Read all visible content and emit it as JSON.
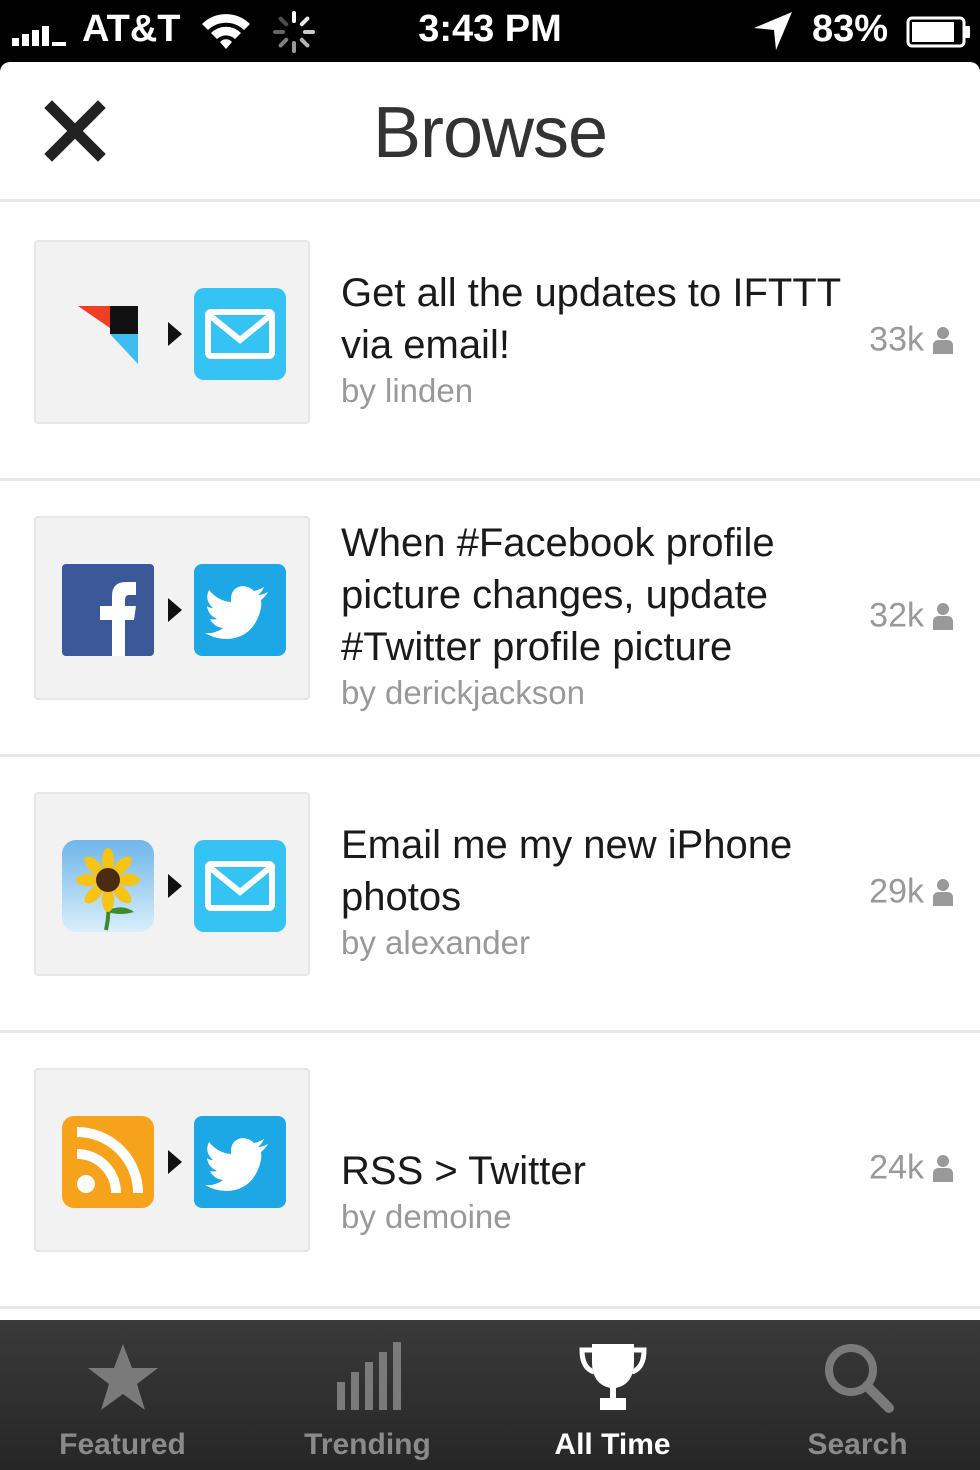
{
  "status_bar": {
    "carrier": "AT&T",
    "time": "3:43 PM",
    "battery_percent": "83%",
    "icons": [
      "signal-icon",
      "wifi-icon",
      "activity-spinner-icon",
      "location-arrow-icon",
      "battery-icon"
    ]
  },
  "navbar": {
    "title": "Browse",
    "close_icon": "close-icon"
  },
  "recipes": [
    {
      "title": "Get all the updates to IFTTT via email!",
      "author": "by linden",
      "count": "33k",
      "trigger_channel": "ifttt-logo-icon",
      "action_channel": "email-icon"
    },
    {
      "title": "When #Facebook profile picture changes, update #Twitter profile picture",
      "author": "by derickjackson",
      "count": "32k",
      "trigger_channel": "facebook-icon",
      "action_channel": "twitter-icon"
    },
    {
      "title": "Email me my new iPhone photos",
      "author": "by alexander",
      "count": "29k",
      "trigger_channel": "iphone-photos-icon",
      "action_channel": "email-icon"
    },
    {
      "title": "RSS > Twitter",
      "author": "by demoine",
      "count": "24k",
      "trigger_channel": "rss-icon",
      "action_channel": "twitter-icon"
    }
  ],
  "tabs": [
    {
      "label": "Featured",
      "icon": "star-icon",
      "active": false
    },
    {
      "label": "Trending",
      "icon": "bar-chart-icon",
      "active": false
    },
    {
      "label": "All Time",
      "icon": "trophy-icon",
      "active": true
    },
    {
      "label": "Search",
      "icon": "search-icon",
      "active": false
    }
  ],
  "colors": {
    "email_blue": "#35c3f3",
    "twitter_blue": "#1da7e5",
    "facebook_blue": "#3b5998",
    "rss_orange": "#f7a21b",
    "tab_bar": "#2e2e2e"
  }
}
